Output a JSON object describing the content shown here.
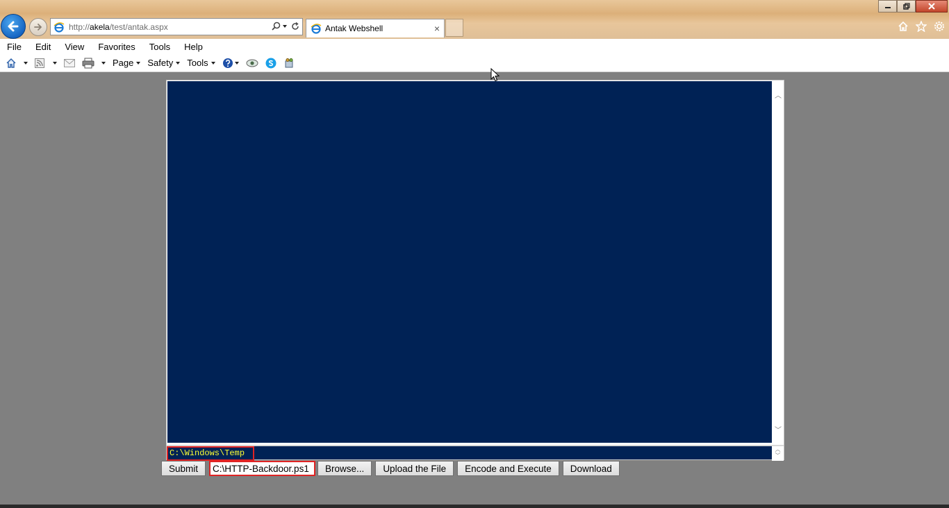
{
  "browser": {
    "url_prefix": "http://",
    "url_host": "akela",
    "url_path": "/test/antak.aspx",
    "tab_title": "Antak Webshell",
    "tab_close": "×"
  },
  "menu": {
    "items": [
      "File",
      "Edit",
      "View",
      "Favorites",
      "Tools",
      "Help"
    ]
  },
  "command_bar": {
    "page_label": "Page",
    "safety_label": "Safety",
    "tools_label": "Tools"
  },
  "console": {
    "output_text": "",
    "input_value": "C:\\Windows\\Temp"
  },
  "actions": {
    "submit_label": "Submit",
    "file_path": "C:\\HTTP-Backdoor.ps1",
    "browse_label": "Browse...",
    "upload_label": "Upload the File",
    "encode_label": "Encode and Execute",
    "download_label": "Download"
  },
  "colors": {
    "console_bg": "#002255",
    "console_text": "#ffff33",
    "highlight_border": "#e02424"
  }
}
